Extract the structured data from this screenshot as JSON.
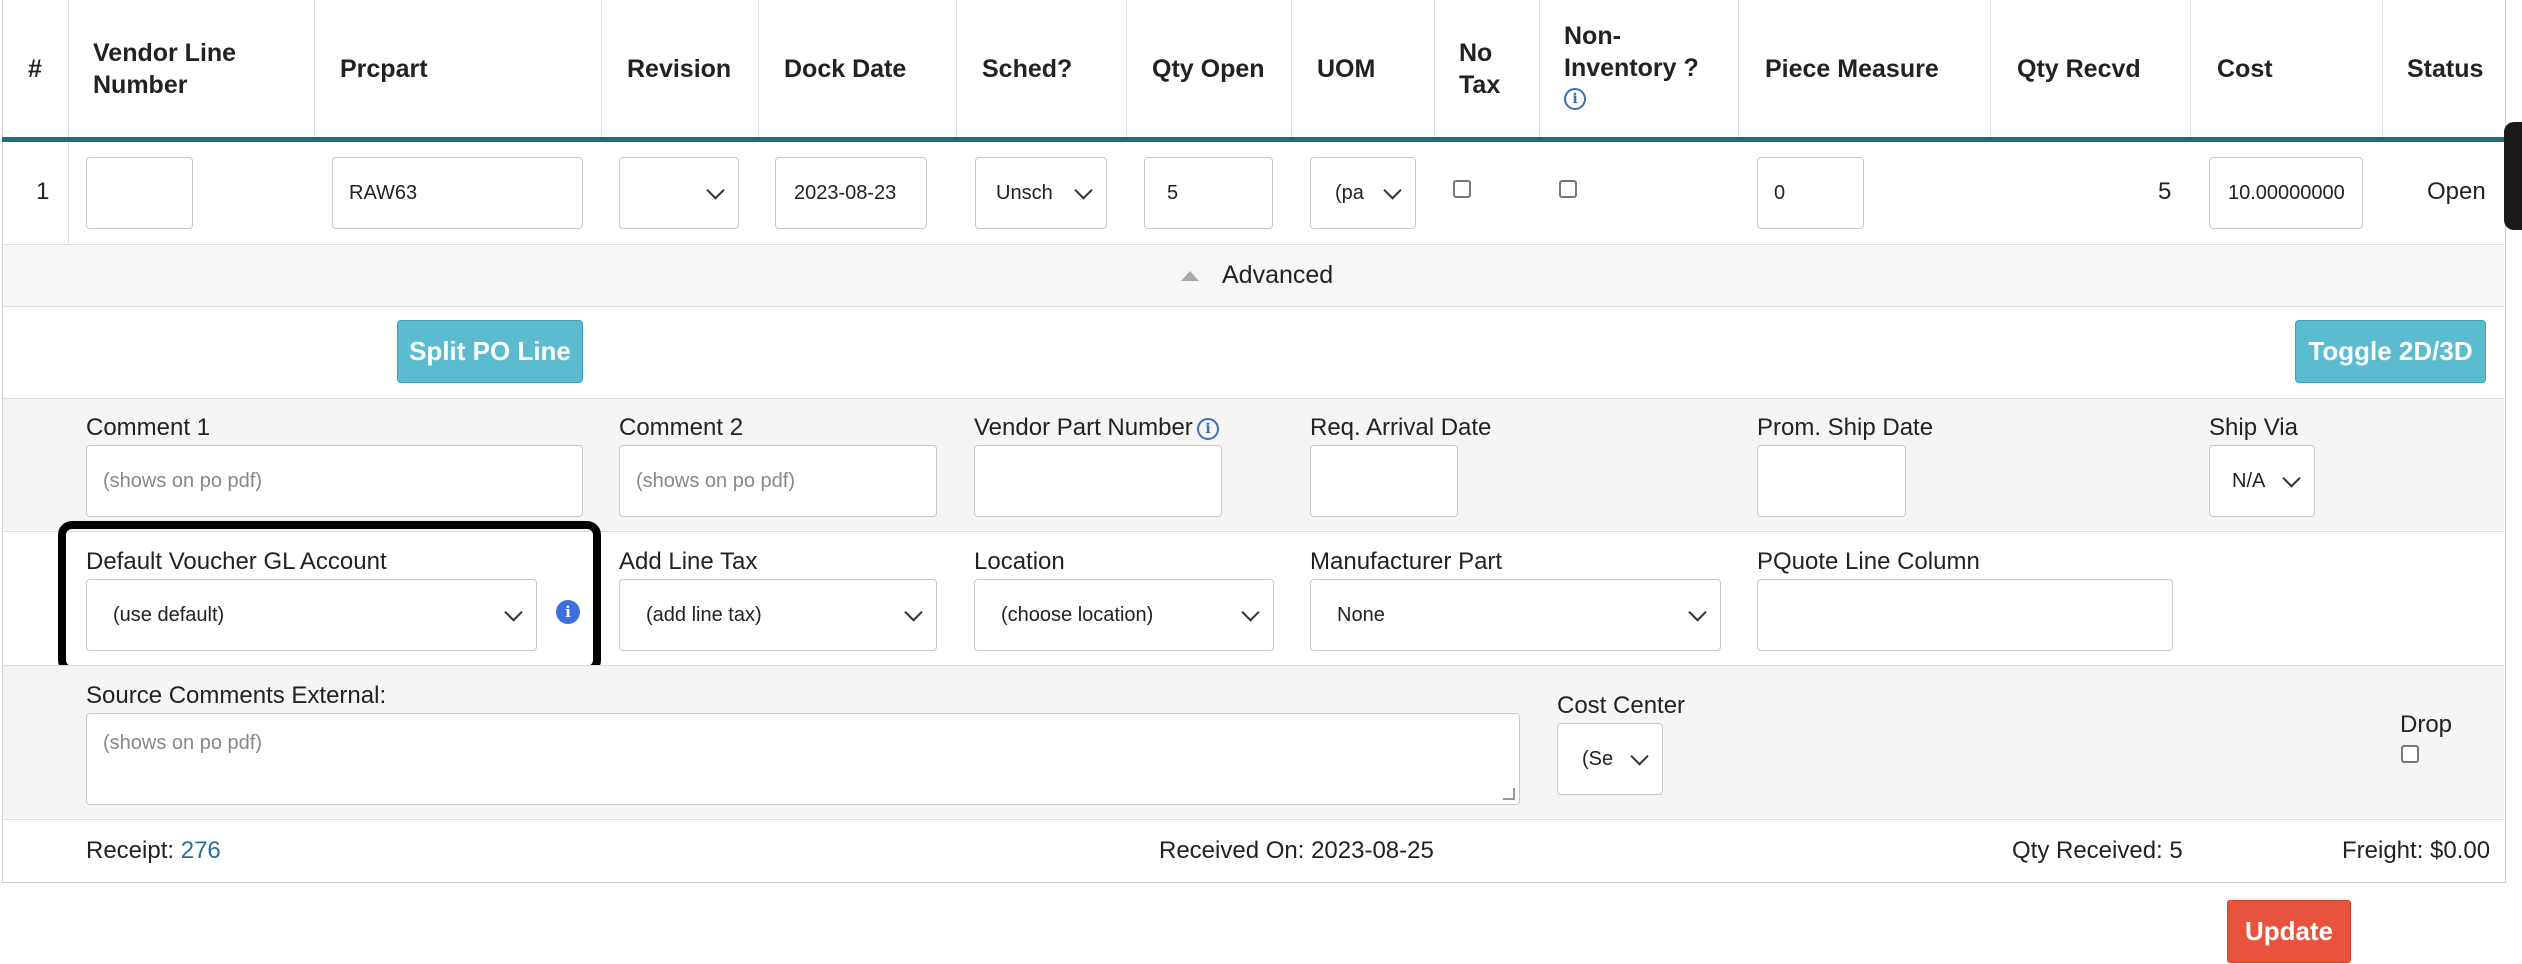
{
  "table": {
    "headers": [
      "#",
      "Vendor Line Number",
      "Prcpart",
      "Revision",
      "Dock Date",
      "Sched?",
      "Qty Open",
      "UOM",
      "No Tax",
      "Non-Inventory ?",
      "Piece Measure",
      "Qty Recvd",
      "Cost",
      "Status"
    ],
    "row": {
      "index": "1",
      "vendor_line_number": "",
      "prcpart": "RAW63",
      "revision": "",
      "dock_date": "2023-08-23",
      "sched": "Unsch",
      "qty_open": "5",
      "uom": "(pa",
      "piece_measure": "0",
      "qty_recvd": "5",
      "cost": "10.00000000",
      "status": "Open"
    }
  },
  "advanced": {
    "label": "Advanced"
  },
  "buttons": {
    "split_po_line": "Split PO Line",
    "toggle_2d3d": "Toggle 2D/3D",
    "update": "Update"
  },
  "fields": {
    "comment1": {
      "label": "Comment 1",
      "placeholder": "(shows on po pdf)"
    },
    "comment2": {
      "label": "Comment 2",
      "placeholder": "(shows on po pdf)"
    },
    "vendor_part_number": {
      "label": "Vendor Part Number",
      "value": ""
    },
    "req_arrival_date": {
      "label": "Req. Arrival Date",
      "value": ""
    },
    "prom_ship_date": {
      "label": "Prom. Ship Date",
      "value": ""
    },
    "ship_via": {
      "label": "Ship Via",
      "value": "N/A"
    },
    "default_voucher_gl": {
      "label": "Default Voucher GL Account",
      "value": "(use default)"
    },
    "add_line_tax": {
      "label": "Add Line Tax",
      "value": "(add line tax)"
    },
    "location": {
      "label": "Location",
      "value": "(choose location)"
    },
    "manufacturer_part": {
      "label": "Manufacturer Part",
      "value": "None"
    },
    "pquote_line_column": {
      "label": "PQuote Line Column",
      "value": ""
    },
    "source_comments_external": {
      "label": "Source Comments External:",
      "placeholder": "(shows on po pdf)"
    },
    "cost_center": {
      "label": "Cost Center",
      "value": "(Se"
    },
    "drop": {
      "label": "Drop"
    }
  },
  "footer": {
    "receipt_label": "Receipt:",
    "receipt_value": "276",
    "received_on": "Received On: 2023-08-25",
    "qty_received": "Qty Received: 5",
    "freight": "Freight: $0.00"
  },
  "icons": {
    "info": "i"
  },
  "colors": {
    "header_rule": "#1e6e80",
    "teal_button": "#5bbccf",
    "update_button": "#e8533d",
    "link": "#2a6f94",
    "info": "#3e6fe0"
  }
}
